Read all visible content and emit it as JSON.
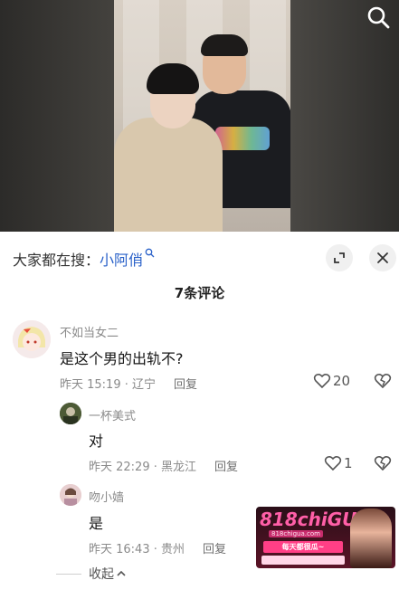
{
  "search_hint": {
    "prefix": "大家都在搜：",
    "term": "小阿俏"
  },
  "comment_count": "7条评论",
  "comments": [
    {
      "user": "不如当女二",
      "text": "是这个男的出轨不?",
      "time": "昨天 15:19 · 辽宁",
      "reply": "回复",
      "likes": "20"
    },
    {
      "user": "一杯美式",
      "text": "对",
      "time": "昨天 22:29 · 黑龙江",
      "reply": "回复",
      "likes": "1"
    },
    {
      "user": "吻小嫱",
      "text": "是",
      "time": "昨天 16:43 · 贵州",
      "reply": "回复",
      "likes": ""
    }
  ],
  "collapse_label": "收起",
  "watermark": {
    "title": "818chiGUA",
    "site": "818chigua.com",
    "slogan": "每天都很瓜~"
  },
  "colors": {
    "accent": "#2b62c9",
    "meta": "#8a8a8a",
    "text": "#161616"
  },
  "icons": [
    "search-icon",
    "expand-icon",
    "close-icon",
    "heart-icon",
    "dislike-heart-icon",
    "chevron-up-icon"
  ]
}
